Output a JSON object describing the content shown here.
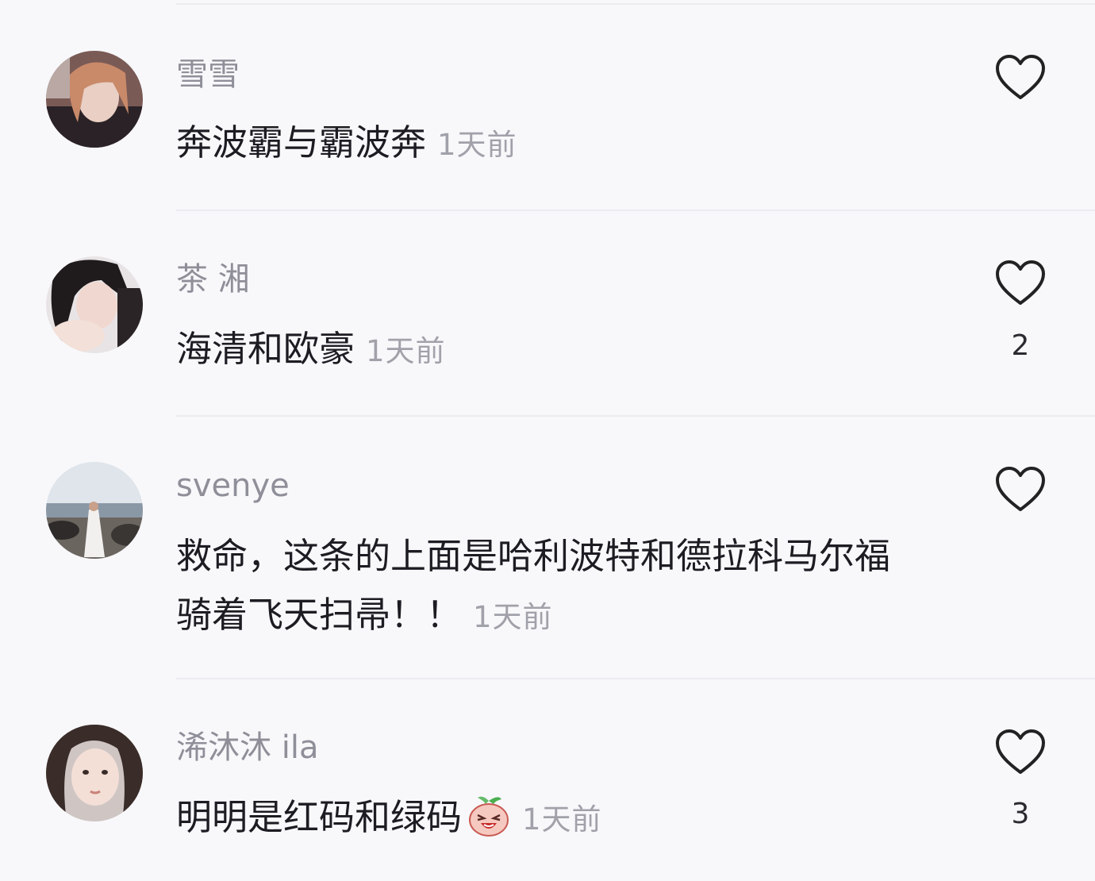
{
  "comments": [
    {
      "username": "雪雪",
      "text": "奔波霸与霸波奔",
      "time": "1天前",
      "likes": ""
    },
    {
      "username": "茶 湘",
      "text": "海清和欧豪",
      "time": "1天前",
      "likes": "2"
    },
    {
      "username": "svenye",
      "text": "救命，这条的上面是哈利波特和德拉科马尔福骑着飞天扫帚！！",
      "time": "1天前",
      "likes": ""
    },
    {
      "username": "浠沐沐 ila",
      "text": "明明是红码和绿码",
      "time": "1天前",
      "likes": "3",
      "emoji": "laughing-blob-emoji"
    }
  ],
  "icons": {
    "like": "heart-outline-icon"
  },
  "colors": {
    "background": "#f8f8fb",
    "username": "#8f8f99",
    "comment_text": "#1c1c22",
    "timestamp": "#a1a1aa"
  }
}
